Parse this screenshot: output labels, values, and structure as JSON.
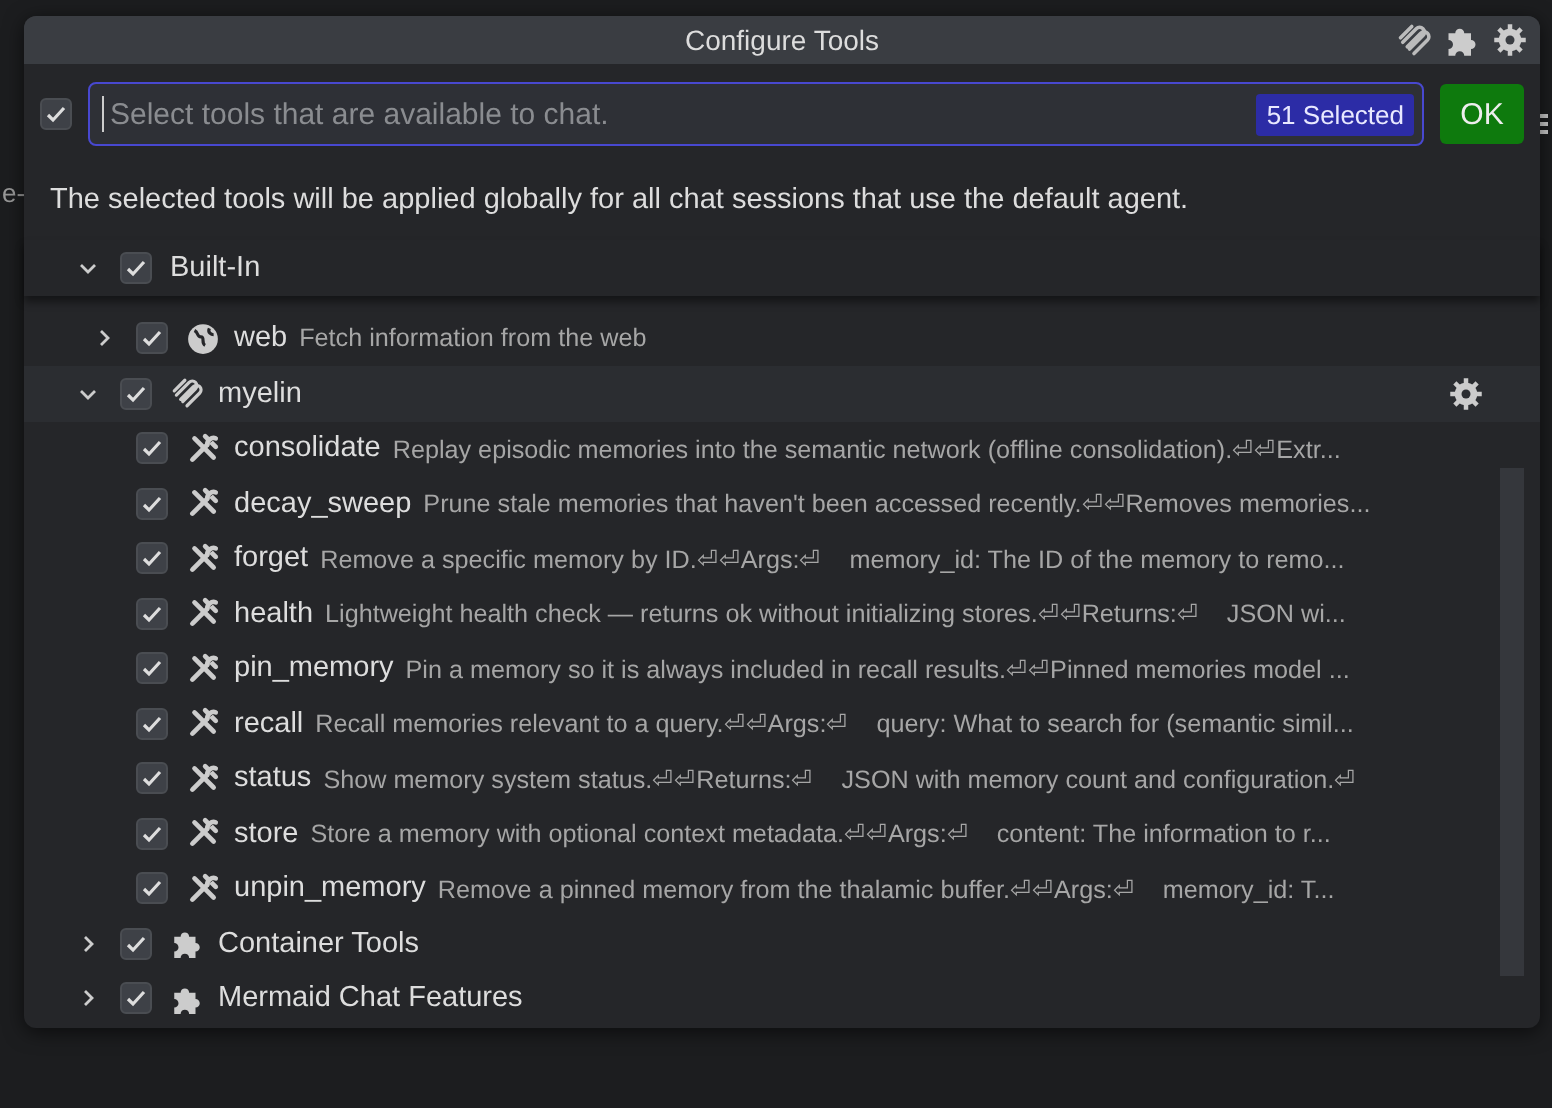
{
  "background": {
    "fragment": "e-"
  },
  "dialog": {
    "title": "Configure Tools",
    "search": {
      "checked": true,
      "placeholder": "Select tools that are available to chat.",
      "badge": "51 Selected"
    },
    "ok_button": "OK",
    "notice": "The selected tools will be applied globally for all chat sessions that use the default agent.",
    "tree": [
      {
        "kind": "group",
        "label": "Built-In",
        "checked": true,
        "expanded": true,
        "settings": false,
        "children": [
          {
            "kind": "web",
            "label": "web",
            "description": "Fetch information from the web",
            "checked": true,
            "expanded": false,
            "settings": false
          }
        ]
      },
      {
        "kind": "server",
        "label": "myelin",
        "checked": true,
        "expanded": true,
        "settings": true,
        "children": [
          {
            "kind": "tool",
            "label": "consolidate",
            "description": "Replay episodic memories into the semantic network (offline consolidation).⏎⏎Extr...",
            "checked": true,
            "settings": false
          },
          {
            "kind": "tool",
            "label": "decay_sweep",
            "description": "Prune stale memories that haven't been accessed recently.⏎⏎Removes memories...",
            "checked": true,
            "settings": false
          },
          {
            "kind": "tool",
            "label": "forget",
            "description": "Remove a specific memory by ID.⏎⏎Args:⏎    memory_id: The ID of the memory to remo...",
            "checked": true,
            "settings": false
          },
          {
            "kind": "tool",
            "label": "health",
            "description": "Lightweight health check — returns ok without initializing stores.⏎⏎Returns:⏎    JSON wi...",
            "checked": true,
            "settings": false
          },
          {
            "kind": "tool",
            "label": "pin_memory",
            "description": "Pin a memory so it is always included in recall results.⏎⏎Pinned memories model ...",
            "checked": true,
            "settings": false
          },
          {
            "kind": "tool",
            "label": "recall",
            "description": "Recall memories relevant to a query.⏎⏎Args:⏎    query: What to search for (semantic simil...",
            "checked": true,
            "settings": false
          },
          {
            "kind": "tool",
            "label": "status",
            "description": "Show memory system status.⏎⏎Returns:⏎    JSON with memory count and configuration.⏎",
            "checked": true,
            "settings": false
          },
          {
            "kind": "tool",
            "label": "store",
            "description": "Store a memory with optional context metadata.⏎⏎Args:⏎    content: The information to r...",
            "checked": true,
            "settings": false
          },
          {
            "kind": "tool",
            "label": "unpin_memory",
            "description": "Remove a pinned memory from the thalamic buffer.⏎⏎Args:⏎    memory_id: T...",
            "checked": true,
            "settings": false
          }
        ]
      },
      {
        "kind": "extension",
        "label": "Container Tools",
        "checked": true,
        "expanded": false,
        "settings": false
      },
      {
        "kind": "extension",
        "label": "Mermaid Chat Features",
        "checked": true,
        "expanded": false,
        "settings": false
      }
    ]
  }
}
